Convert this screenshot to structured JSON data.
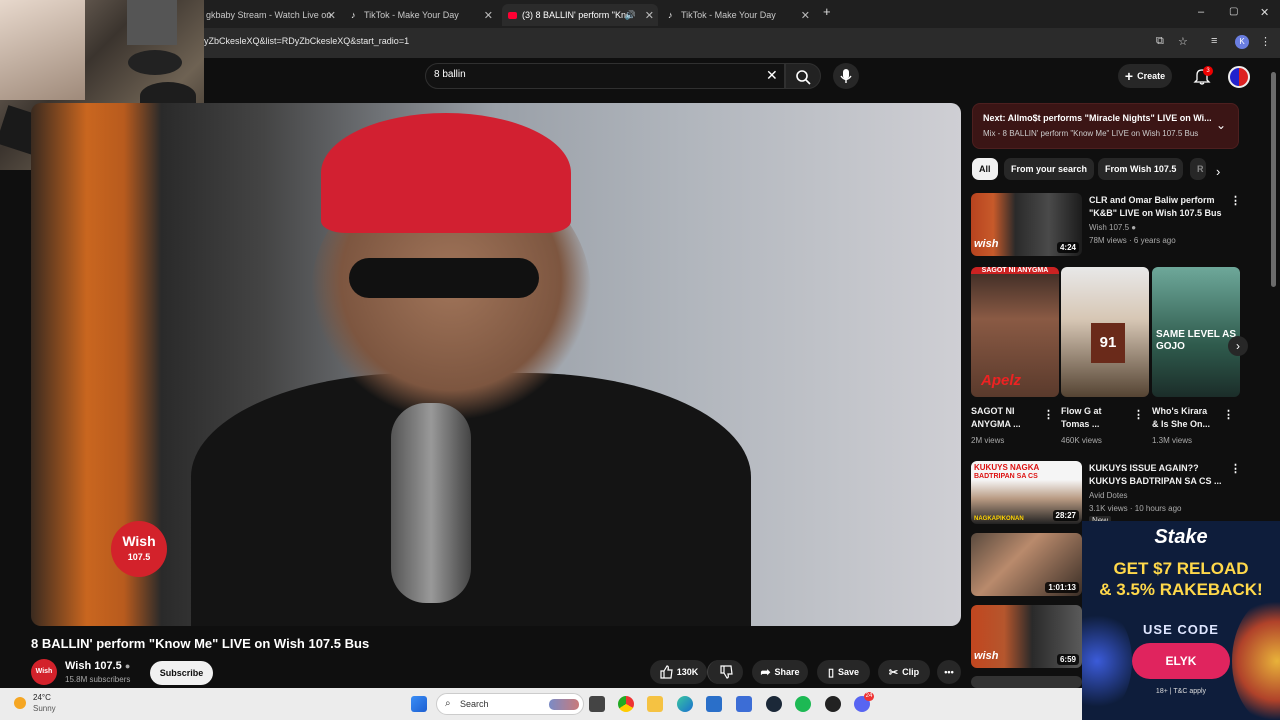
{
  "browser": {
    "tabs": [
      {
        "label": "gkbaby Stream - Watch Live on"
      },
      {
        "label": "TikTok - Make Your Day"
      },
      {
        "label": "(3) 8 BALLIN' perform \"Kno"
      },
      {
        "label": "TikTok - Make Your Day"
      }
    ],
    "new_tab": "+",
    "window_controls": {
      "minimize": "–",
      "restore": "▢",
      "close": "✕"
    },
    "url": "yZbCkesleXQ&list=RDyZbCkesleXQ&start_radio=1",
    "profile_initial": "K"
  },
  "webcam": {},
  "masthead": {
    "search_value": "8 ballin",
    "create_label": "Create",
    "notification_count": "3"
  },
  "player": {
    "logo_line1": "Wish",
    "logo_line2": "107.5"
  },
  "video": {
    "title": "8 BALLIN' perform \"Know Me\" LIVE on Wish 107.5 Bus",
    "channel_avatar": "Wish 107.5",
    "channel_name": "Wish 107.5",
    "subscribers": "15.8M subscribers",
    "subscribe_label": "Subscribe",
    "likes": "130K",
    "share_label": "Share",
    "save_label": "Save",
    "clip_label": "Clip"
  },
  "sidebar": {
    "next_title": "Next: Allmo$t performs \"Miracle Nights\" LIVE on Wi...",
    "next_subtitle": "Mix - 8 BALLIN' perform \"Know Me\" LIVE on Wish 107.5 Bus",
    "chips": [
      "All",
      "From your search",
      "From Wish 107.5",
      "R"
    ],
    "rec1": {
      "title1": "CLR and Omar Baliw perform",
      "title2": "\"K&B\" LIVE on Wish 107.5 Bus",
      "channel": "Wish 107.5",
      "meta": "78M views · 6 years ago",
      "duration": "4:24"
    },
    "shorts": [
      {
        "title1": "SAGOT NI",
        "title2": "ANYGMA ...",
        "views": "2M views",
        "overlay": "Apelz",
        "top_text": "SAGOT NI ANYGMA"
      },
      {
        "title1": "Flow G at",
        "title2": "Tomas ...",
        "views": "460K views",
        "overlay": "91",
        "top_text": ""
      },
      {
        "title1": "Who's Kirara",
        "title2": "& Is She On...",
        "views": "1.3M views",
        "overlay": "SAME LEVEL AS GOJO",
        "top_text": ""
      }
    ],
    "rec2": {
      "title1": "KUKUYS ISSUE AGAIN??",
      "title2": "KUKUYS BADTRIPAN SA CS ...",
      "channel": "Avid Dotes",
      "meta": "3.1K views · 10 hours ago",
      "duration": "28:27",
      "badge": "New",
      "thumb_top": "KUKUYS NAGKA",
      "thumb_mid": "BADTRIPAN SA CS",
      "thumb_bottom": "NAGKAPIKONAN"
    },
    "rec3": {
      "duration": "1:01:13"
    },
    "rec4": {
      "duration": "6:59"
    }
  },
  "ad": {
    "logo": "Stake",
    "headline1": "GET $7 RELOAD",
    "headline2": "& 3.5% RAKEBACK!",
    "code_label": "USE CODE",
    "code": "ELYK",
    "footer": "18+ | T&C apply"
  },
  "taskbar": {
    "temperature": "24°C",
    "condition": "Sunny",
    "search_label": "Search",
    "discord_badge": "24"
  }
}
